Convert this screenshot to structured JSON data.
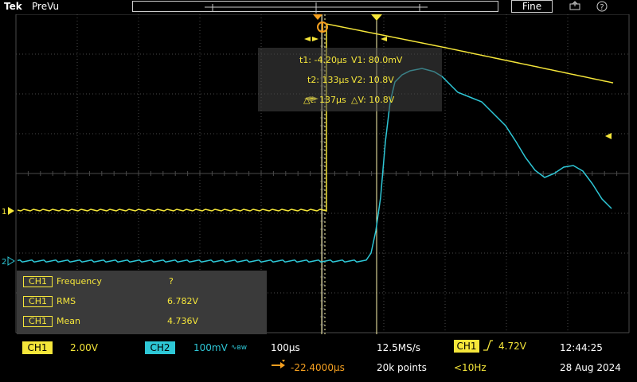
{
  "topbar": {
    "brand": "Tek",
    "mode": "PreVu",
    "fine_label": "Fine",
    "icons": [
      "save-icon",
      "help-icon"
    ],
    "help_glyph": "?"
  },
  "markers": {
    "trigger_pos_glyph": "T",
    "ch1_label": "1",
    "ch2_label": "2"
  },
  "cursors": {
    "t1": "t1: -4.20µs",
    "v1": "V1: 80.0mV",
    "t2": "t2: 133µs",
    "v2": "V2: 10.8V",
    "dt": "△t: 137µs",
    "dv": "△V: 10.8V"
  },
  "measurements": [
    {
      "channel": "CH1",
      "name": "Frequency",
      "value": "?"
    },
    {
      "channel": "CH1",
      "name": "RMS",
      "value": "6.782V"
    },
    {
      "channel": "CH1",
      "name": "Mean",
      "value": "4.736V"
    }
  ],
  "status": {
    "ch1_tag": "CH1",
    "ch1_scale": "2.00V",
    "ch2_tag": "CH2",
    "ch2_scale": "100mV",
    "ch2_bw": "∿ʙw",
    "timebase": "100µs",
    "sample_rate": "12.5MS/s",
    "trig_tag": "CH1",
    "trig_level": "4.72V",
    "time": "12:44:25",
    "delay": "-22.4000µs",
    "points": "20k points",
    "trig_freq": "<10Hz",
    "date": "28 Aug 2024"
  },
  "colors": {
    "ch1": "#f5e63a",
    "ch2": "#2ec7d6",
    "grid": "#4a4a4a"
  }
}
